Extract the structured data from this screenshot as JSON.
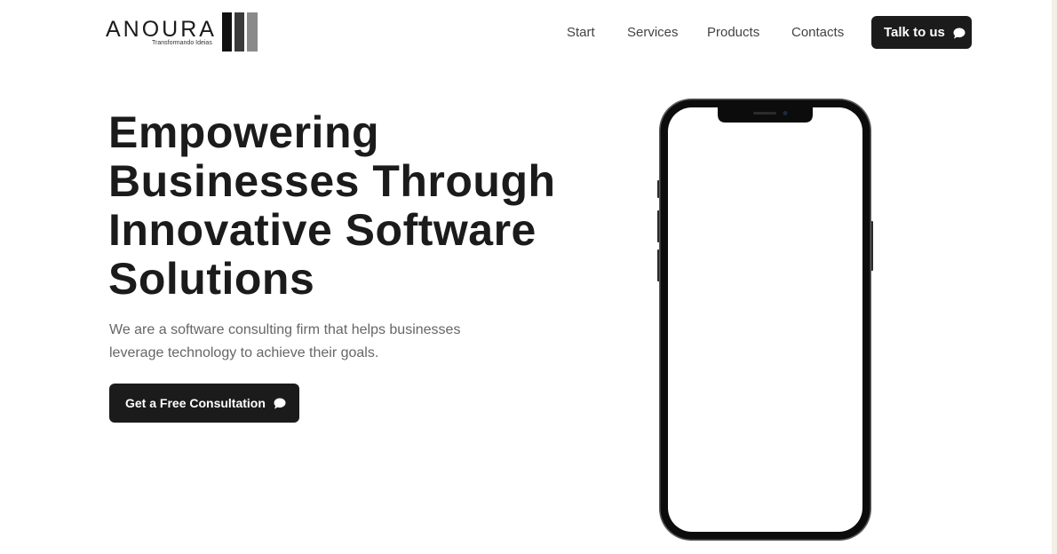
{
  "brand": {
    "name": "ANOURA",
    "tagline": "Transformando Ideias"
  },
  "nav": {
    "items": [
      "Start",
      "Services",
      "Products",
      "Contacts"
    ],
    "cta_label": "Talk to us"
  },
  "hero": {
    "title": "Empowering Businesses Through Innovative Software Solutions",
    "subtitle": "We are a software consulting firm that helps businesses leverage technology to achieve their goals.",
    "cta_label": "Get a Free Consultation"
  },
  "icons": {
    "cta": "chat-bubble-icon",
    "hero_visual": "smartphone"
  },
  "colors": {
    "background": "#ffffff",
    "primary_button": "#1b1b1b",
    "text": "#1b1b1b",
    "muted_text": "#666666",
    "side_strip": "#f4efe6"
  }
}
